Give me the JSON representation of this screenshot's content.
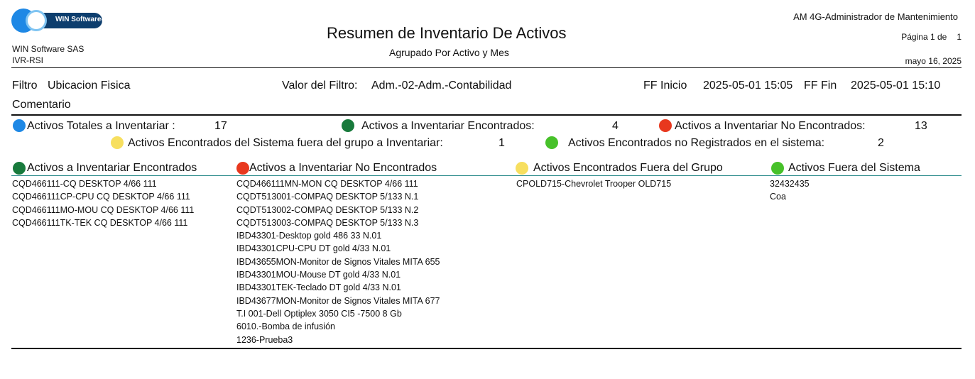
{
  "header": {
    "logo_text": "WIN Software",
    "logo_suffix": "SAS",
    "company": "WIN Software SAS",
    "subcompany": "IVR-RSI",
    "title": "Resumen de Inventario De Activos",
    "subtitle": "Agrupado Por Activo y Mes",
    "app_name": "AM 4G-Administrador de Mantenimiento",
    "page_label": "Página 1 de",
    "page_total": "1",
    "date": "mayo 16, 2025"
  },
  "filter": {
    "label": "Filtro",
    "field": "Ubicacion Fisica",
    "value_label": "Valor del Filtro:",
    "value": "Adm.-02-Adm.-Contabilidad",
    "start_label": "FF Inicio",
    "start": "2025-05-01 15:05",
    "end_label": "FF Fin",
    "end": "2025-05-01 15:10",
    "comment_label": "Comentario"
  },
  "summary": {
    "total_label": "Activos Totales a Inventariar :",
    "total_value": "17",
    "found_label": "Activos a Inventariar Encontrados:",
    "found_value": "4",
    "not_found_label": "Activos a Inventariar No Encontrados:",
    "not_found_value": "13",
    "outside_group_label": "Activos Encontrados del Sistema fuera del grupo a Inventariar:",
    "outside_group_value": "1",
    "unregistered_label": "Activos Encontrados no Registrados en el sistema:",
    "unregistered_value": "2"
  },
  "colors": {
    "total": "#1e88e5",
    "found": "#187a3c",
    "not_found": "#e8381e",
    "outside_group": "#f7df5f",
    "unregistered": "#47c12a"
  },
  "columns": {
    "found": {
      "title": "Activos a Inventariar Encontrados",
      "items": [
        "CQD466111-CQ DESKTOP 4/66 111",
        "CQD466111CP-CPU CQ DESKTOP 4/66 111",
        "CQD466111MO-MOU CQ DESKTOP 4/66 111",
        "CQD466111TK-TEK CQ DESKTOP 4/66 111"
      ]
    },
    "not_found": {
      "title": "Activos a Inventariar No Encontrados",
      "items": [
        "CQD466111MN-MON CQ DESKTOP 4/66 111",
        "CQDT513001-COMPAQ DESKTOP 5/133 N.1",
        "CQDT513002-COMPAQ DESKTOP 5/133 N.2",
        "CQDT513003-COMPAQ DESKTOP 5/133 N.3",
        "IBD43301-Desktop gold 486 33 N.01",
        "IBD43301CPU-CPU DT gold 4/33 N.01",
        "IBD43655MON-Monitor de Signos Vitales MITA 655",
        "IBD43301MOU-Mouse DT gold 4/33 N.01",
        "IBD43301TEK-Teclado DT gold 4/33 N.01",
        "IBD43677MON-Monitor de Signos Vitales MITA 677",
        "T.I 001-Dell Optiplex 3050 CI5 -7500 8 Gb",
        "6010.-Bomba de infusión",
        "1236-Prueba3"
      ]
    },
    "outside_group": {
      "title": "Activos Encontrados Fuera del Grupo",
      "items": [
        "CPOLD715-Chevrolet Trooper OLD715"
      ]
    },
    "unregistered": {
      "title": "Activos Fuera del Sistema",
      "items": [
        "32432435",
        "Coa"
      ]
    }
  }
}
